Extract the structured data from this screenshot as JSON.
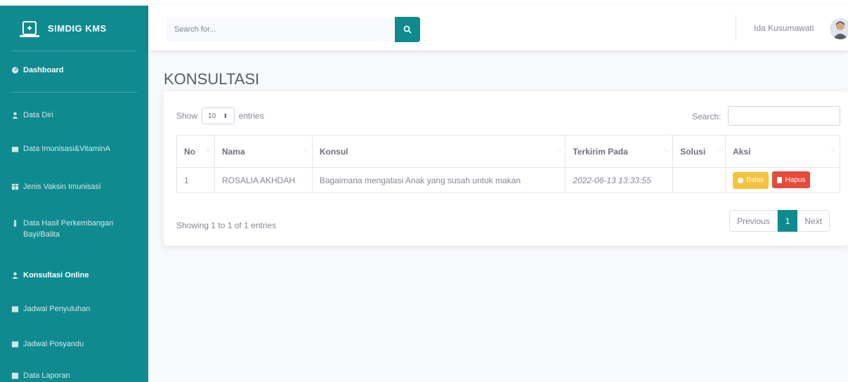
{
  "brand": {
    "name": "SIMDIG KMS"
  },
  "sidebar": {
    "items": [
      {
        "label": "Dashboard"
      },
      {
        "label": "Data Diri"
      },
      {
        "label": "Data Imunisasi&VitaminA"
      },
      {
        "label": "Jenis Vaksin Imunisasi"
      },
      {
        "label": "Data Hasil Perkembangan Bayi/Balita"
      },
      {
        "label": "Konsultasi Online"
      },
      {
        "label": "Jadwal Penyuluhan"
      },
      {
        "label": "Jadwal Posyandu"
      },
      {
        "label": "Data Laporan"
      }
    ]
  },
  "topbar": {
    "search_placeholder": "Search for...",
    "user_name": "Ida Kusumawati"
  },
  "page": {
    "title": "KONSULTASI"
  },
  "datatable": {
    "show_label": "Show",
    "entries_value": "10",
    "entries_label": "entries",
    "search_label": "Search:",
    "columns": [
      "No",
      "Nama",
      "Konsul",
      "Terkirim Pada",
      "Solusi",
      "Aksi"
    ],
    "rows": [
      {
        "no": "1",
        "nama": "ROSALIA AKHDAH",
        "konsul": "Bagaimana mengatasi Anak yang susah untuk makan",
        "terkirim_pada": "2022-06-13 13:33:55",
        "solusi": "",
        "balas_label": "Balas",
        "hapus_label": "Hapus"
      }
    ],
    "info": "Showing 1 to 1 of 1 entries",
    "pagination": {
      "previous": "Previous",
      "current": "1",
      "next": "Next"
    }
  },
  "colors": {
    "primary": "#0f8a8f",
    "warning": "#f6c23e",
    "danger": "#e74a3b",
    "background": "#f8f9fc"
  }
}
